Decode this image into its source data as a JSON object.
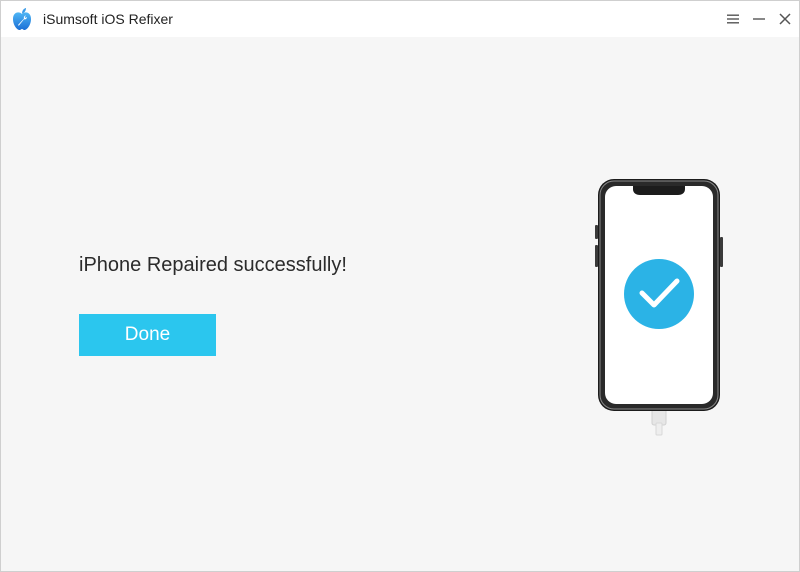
{
  "window": {
    "title": "iSumsoft iOS Refixer",
    "app_icon": "apple-wrench-icon",
    "controls": [
      "menu-icon",
      "minimize-icon",
      "close-icon"
    ]
  },
  "main": {
    "status_message": "iPhone Repaired successfully!",
    "done_label": "Done",
    "illustration_icon": "iphone-check-icon"
  },
  "colors": {
    "accent": "#2bc6ee",
    "check_circle": "#2bb3e6",
    "background": "#f6f6f6"
  }
}
